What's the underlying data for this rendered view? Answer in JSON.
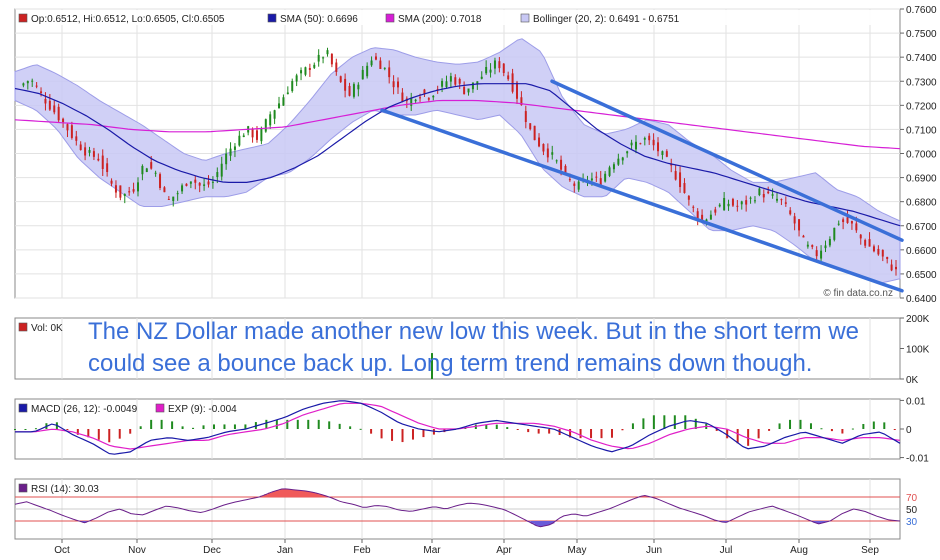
{
  "annotation": {
    "line1": "The NZ Dollar made another new low this week. But in the short term we",
    "line2": "could see a bounce back up. Long term trend remains down though."
  },
  "colors": {
    "bull": "#1f8a1f",
    "bear": "#cc2222",
    "sma50": "#1a1aa8",
    "sma200": "#d61fd6",
    "bollinger_fill": "#c8c8f4",
    "bollinger_edge": "#9d9de8",
    "trendline": "#3a6fd8",
    "macd": "#1a1aa8",
    "macd_signal": "#e01fc8",
    "rsi": "#6a1f8a",
    "rsi_overbought_fill": "#f05a5a",
    "rsi_oversold_fill": "#6a5ad8",
    "rsi_level": "#e05050",
    "text_blue": "#3a6fd8"
  },
  "chart_data": [
    {
      "type": "candlestick",
      "panel": "price",
      "legend": [
        {
          "marker": "ohlc",
          "text": "Op:0.6512, Hi:0.6512, Lo:0.6505, Cl:0.6505"
        },
        {
          "marker": "sma50",
          "text": "SMA (50): 0.6696"
        },
        {
          "marker": "sma200",
          "text": "SMA (200): 0.7018"
        },
        {
          "marker": "bollinger",
          "text": "Bollinger (20, 2): 0.6491 - 0.6751"
        }
      ],
      "x_labels": [
        "Oct",
        "Nov",
        "Dec",
        "Jan",
        "Feb",
        "Mar",
        "Apr",
        "May",
        "Jun",
        "Jul",
        "Aug",
        "Sep"
      ],
      "ylim": [
        0.64,
        0.76
      ],
      "y_ticks": [
        "0.7600",
        "0.7500",
        "0.7400",
        "0.7300",
        "0.7200",
        "0.7100",
        "0.7000",
        "0.6900",
        "0.6800",
        "0.6700",
        "0.6600",
        "0.6500",
        "0.6400"
      ],
      "close_series": [
        0.728,
        0.731,
        0.724,
        0.718,
        0.712,
        0.705,
        0.7,
        0.698,
        0.688,
        0.682,
        0.685,
        0.696,
        0.692,
        0.68,
        0.684,
        0.69,
        0.686,
        0.688,
        0.698,
        0.705,
        0.71,
        0.706,
        0.716,
        0.722,
        0.73,
        0.734,
        0.738,
        0.742,
        0.731,
        0.724,
        0.732,
        0.74,
        0.736,
        0.728,
        0.721,
        0.725,
        0.724,
        0.728,
        0.732,
        0.726,
        0.729,
        0.734,
        0.738,
        0.731,
        0.721,
        0.708,
        0.702,
        0.698,
        0.69,
        0.686,
        0.69,
        0.688,
        0.696,
        0.7,
        0.704,
        0.706,
        0.702,
        0.696,
        0.688,
        0.678,
        0.672,
        0.676,
        0.68,
        0.678,
        0.68,
        0.684,
        0.682,
        0.68,
        0.672,
        0.662,
        0.658,
        0.664,
        0.672,
        0.671,
        0.664,
        0.66,
        0.656,
        0.651
      ],
      "sma50": [
        0.727,
        0.725,
        0.721,
        0.716,
        0.71,
        0.703,
        0.697,
        0.693,
        0.69,
        0.688,
        0.688,
        0.69,
        0.694,
        0.699,
        0.706,
        0.713,
        0.719,
        0.723,
        0.726,
        0.728,
        0.729,
        0.729,
        0.729,
        0.726,
        0.718,
        0.71,
        0.704,
        0.699,
        0.696,
        0.694,
        0.692,
        0.689,
        0.686,
        0.683,
        0.68,
        0.678,
        0.676,
        0.673,
        0.67
      ],
      "sma200": [
        0.714,
        0.713,
        0.712,
        0.71,
        0.709,
        0.709,
        0.71,
        0.711,
        0.714,
        0.717,
        0.72,
        0.722,
        0.722,
        0.721,
        0.719,
        0.717,
        0.715,
        0.713,
        0.711,
        0.709,
        0.707,
        0.705,
        0.703,
        0.702
      ],
      "bollinger_upper": [
        0.734,
        0.737,
        0.733,
        0.728,
        0.722,
        0.717,
        0.712,
        0.706,
        0.7,
        0.697,
        0.7,
        0.702,
        0.704,
        0.712,
        0.722,
        0.733,
        0.74,
        0.744,
        0.743,
        0.74,
        0.738,
        0.737,
        0.738,
        0.742,
        0.748,
        0.742,
        0.723,
        0.712,
        0.708,
        0.71,
        0.714,
        0.712,
        0.705,
        0.7,
        0.693,
        0.688,
        0.688,
        0.69,
        0.692,
        0.685,
        0.682,
        0.676,
        0.672
      ],
      "bollinger_lower": [
        0.722,
        0.718,
        0.71,
        0.698,
        0.69,
        0.684,
        0.678,
        0.678,
        0.68,
        0.682,
        0.682,
        0.684,
        0.69,
        0.692,
        0.698,
        0.706,
        0.713,
        0.718,
        0.716,
        0.716,
        0.718,
        0.716,
        0.714,
        0.716,
        0.708,
        0.694,
        0.686,
        0.682,
        0.682,
        0.69,
        0.688,
        0.684,
        0.676,
        0.668,
        0.668,
        0.67,
        0.668,
        0.662,
        0.655,
        0.652,
        0.65,
        0.646,
        0.648
      ],
      "trendlines": [
        {
          "from": [
            "Feb",
            0.718
          ],
          "to": [
            "Sep",
            0.643
          ]
        },
        {
          "from": [
            "Apr",
            0.73
          ],
          "to": [
            "Sep",
            0.664
          ]
        }
      ],
      "watermark": "© fin data.co.nz"
    },
    {
      "type": "bar",
      "panel": "volume",
      "legend": [
        {
          "marker": "vol",
          "text": "Vol: 0K"
        }
      ],
      "y_ticks": [
        "200K",
        "100K",
        "0K"
      ],
      "ylim": [
        0,
        200000
      ],
      "bars": [
        {
          "x": "Mar",
          "value": 85000
        }
      ]
    },
    {
      "type": "line",
      "panel": "macd",
      "legend": [
        {
          "marker": "macd",
          "text": "MACD (26, 12): -0.0049"
        },
        {
          "marker": "exp",
          "text": "EXP (9): -0.004"
        }
      ],
      "y_ticks": [
        "0.01",
        "0",
        "-0.01"
      ],
      "ylim": [
        -0.0105,
        0.0105
      ],
      "macd": [
        -0.001,
        -0.001,
        0.002,
        -0.002,
        -0.005,
        -0.009,
        -0.008,
        -0.004,
        -0.003,
        -0.004,
        -0.003,
        -0.001,
        0.0,
        0.002,
        0.004,
        0.007,
        0.009,
        0.01,
        0.009,
        0.006,
        0.002,
        0.0,
        -0.001,
        0.0,
        0.002,
        0.003,
        0.002,
        0.001,
        0.0,
        -0.003,
        -0.006,
        -0.008,
        -0.006,
        -0.002,
        0.001,
        0.003,
        0.002,
        -0.002,
        -0.007,
        -0.006,
        -0.003,
        -0.001,
        -0.003,
        -0.005,
        -0.002,
        -0.001,
        -0.005
      ],
      "signal": [
        -0.001,
        -0.001,
        0.0,
        -0.001,
        -0.003,
        -0.006,
        -0.007,
        -0.006,
        -0.005,
        -0.004,
        -0.004,
        -0.002,
        -0.001,
        0.0,
        0.002,
        0.005,
        0.007,
        0.009,
        0.009,
        0.008,
        0.005,
        0.002,
        0.0,
        0.0,
        0.001,
        0.002,
        0.002,
        0.002,
        0.001,
        -0.001,
        -0.004,
        -0.006,
        -0.007,
        -0.005,
        -0.002,
        0.0,
        0.001,
        0.0,
        -0.003,
        -0.005,
        -0.005,
        -0.003,
        -0.003,
        -0.004,
        -0.003,
        -0.003,
        -0.004
      ]
    },
    {
      "type": "line",
      "panel": "rsi",
      "legend": [
        {
          "marker": "rsi",
          "text": "RSI (14): 30.03"
        }
      ],
      "y_ticks": [
        "70",
        "50",
        "30"
      ],
      "levels": [
        70,
        30
      ],
      "ylim": [
        0,
        100
      ],
      "rsi": [
        58,
        62,
        55,
        48,
        40,
        33,
        27,
        35,
        45,
        50,
        42,
        40,
        48,
        55,
        52,
        47,
        44,
        50,
        57,
        62,
        66,
        70,
        78,
        84,
        82,
        80,
        76,
        70,
        62,
        58,
        52,
        56,
        54,
        48,
        46,
        50,
        54,
        50,
        56,
        60,
        58,
        54,
        49,
        40,
        30,
        20,
        24,
        38,
        42,
        38,
        44,
        50,
        58,
        66,
        73,
        68,
        60,
        52,
        46,
        40,
        32,
        27,
        36,
        45,
        50,
        55,
        48,
        41,
        33,
        25,
        30,
        42,
        50,
        46,
        38,
        32,
        30
      ],
      "x_labels": [
        "Oct",
        "Nov",
        "Dec",
        "Jan",
        "Feb",
        "Mar",
        "Apr",
        "May",
        "Jun",
        "Jul",
        "Aug",
        "Sep"
      ]
    }
  ]
}
